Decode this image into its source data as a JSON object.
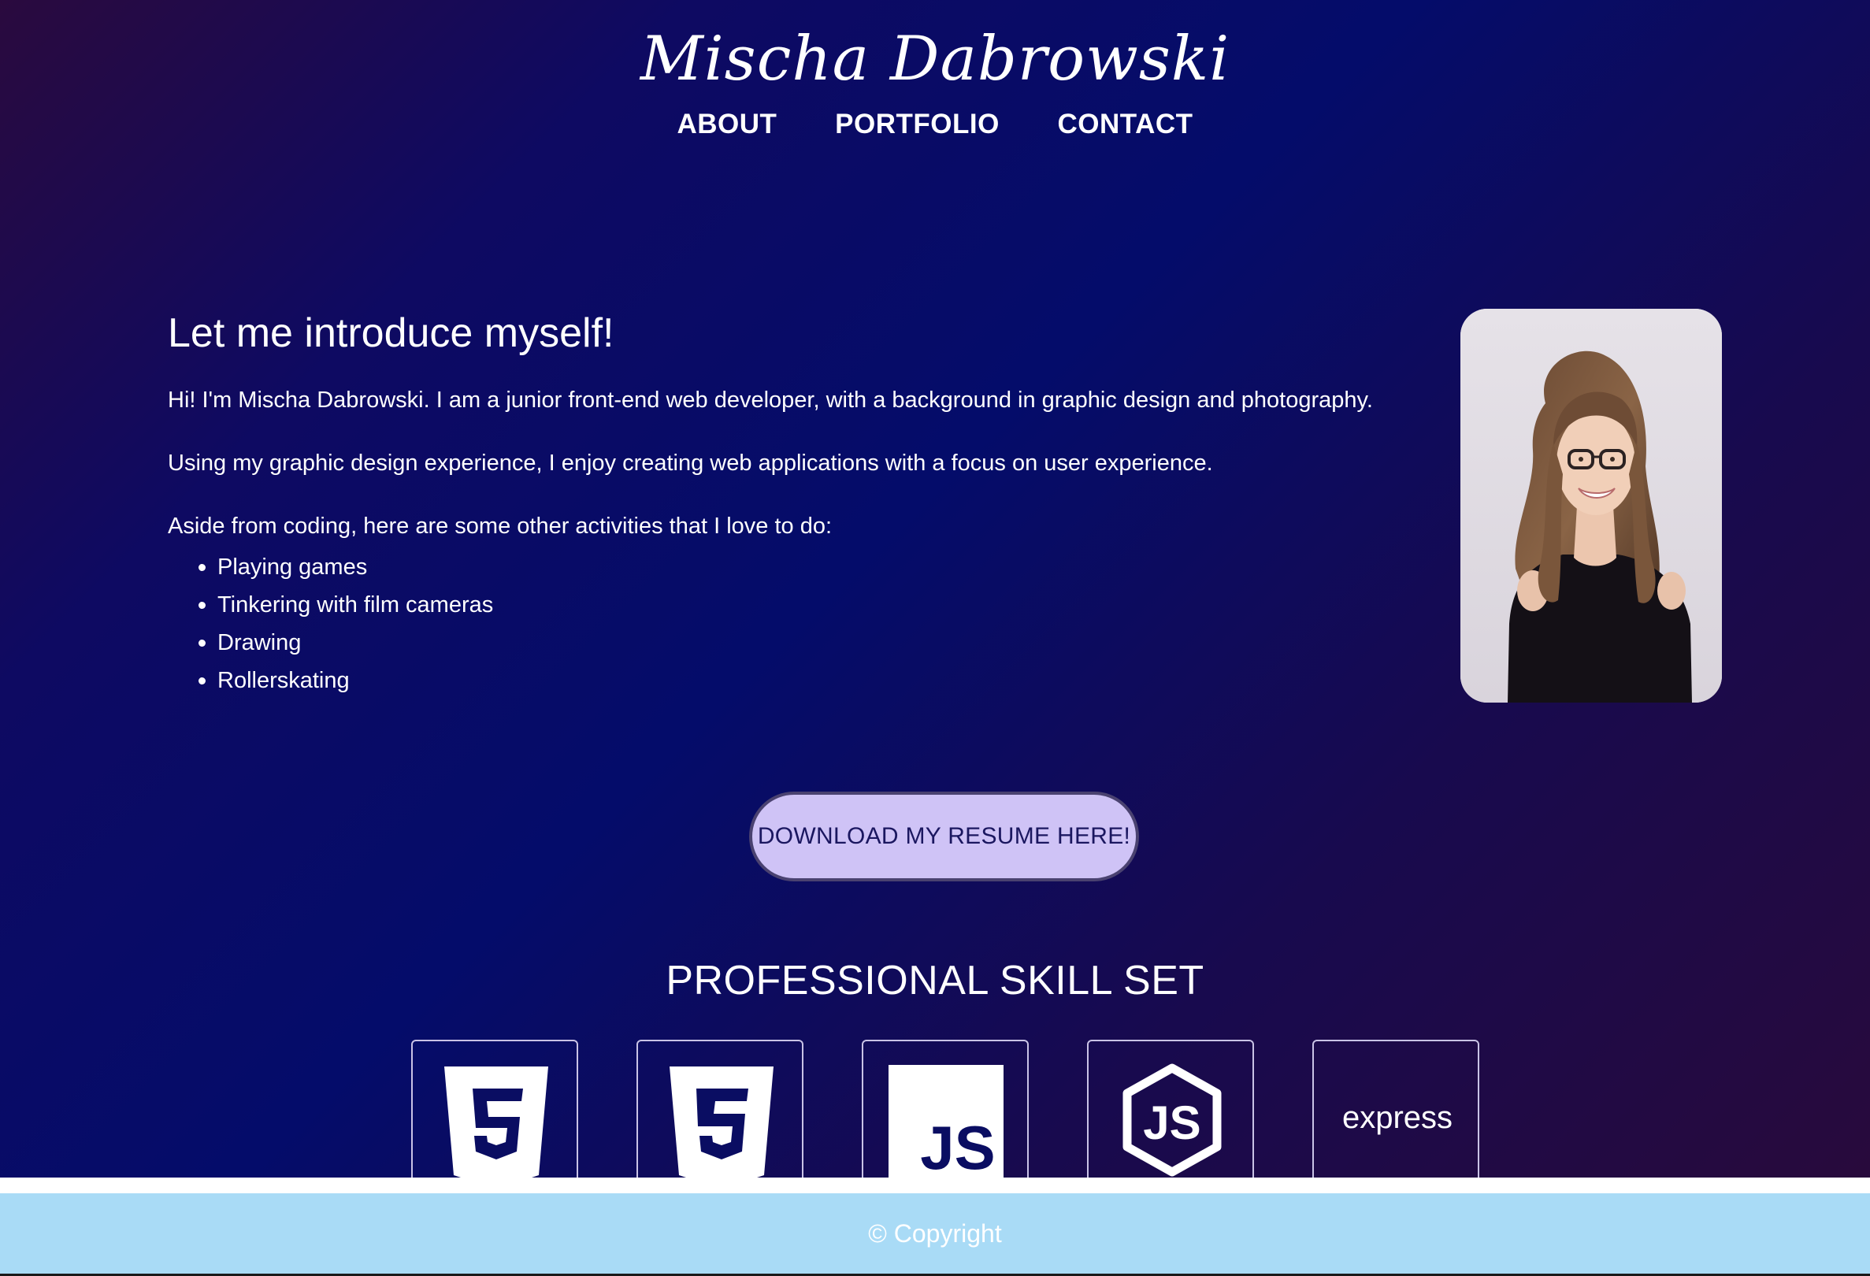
{
  "header": {
    "site_title": "Mischa Dabrowski",
    "nav": [
      {
        "label": "ABOUT"
      },
      {
        "label": "PORTFOLIO"
      },
      {
        "label": "CONTACT"
      }
    ]
  },
  "about": {
    "heading": "Let me introduce myself!",
    "paragraph_1": "Hi! I'm Mischa Dabrowski. I am a junior front-end web developer, with a background in graphic design and photography.",
    "paragraph_2": "Using my graphic design experience, I enjoy creating web applications with a focus on user experience.",
    "activities_intro": "Aside from coding, here are some other activities that I love to do:",
    "activities": [
      "Playing games",
      "Tinkering with film cameras",
      "Drawing",
      "Rollerskating"
    ]
  },
  "resume_button": {
    "label": "DOWNLOAD MY RESUME HERE!"
  },
  "skills": {
    "title": "PROFESSIONAL SKILL SET",
    "icons": [
      {
        "name": "html5-icon"
      },
      {
        "name": "css3-icon"
      },
      {
        "name": "javascript-icon",
        "text": "JS"
      },
      {
        "name": "nodejs-icon",
        "text": "JS"
      },
      {
        "name": "express-icon",
        "text": "express"
      }
    ]
  },
  "footer": {
    "text": "© Copyright"
  },
  "colors": {
    "button_bg": "#cfc3f6",
    "footer_bg": "#a9dbf6",
    "background_navy": "#040c6a"
  }
}
